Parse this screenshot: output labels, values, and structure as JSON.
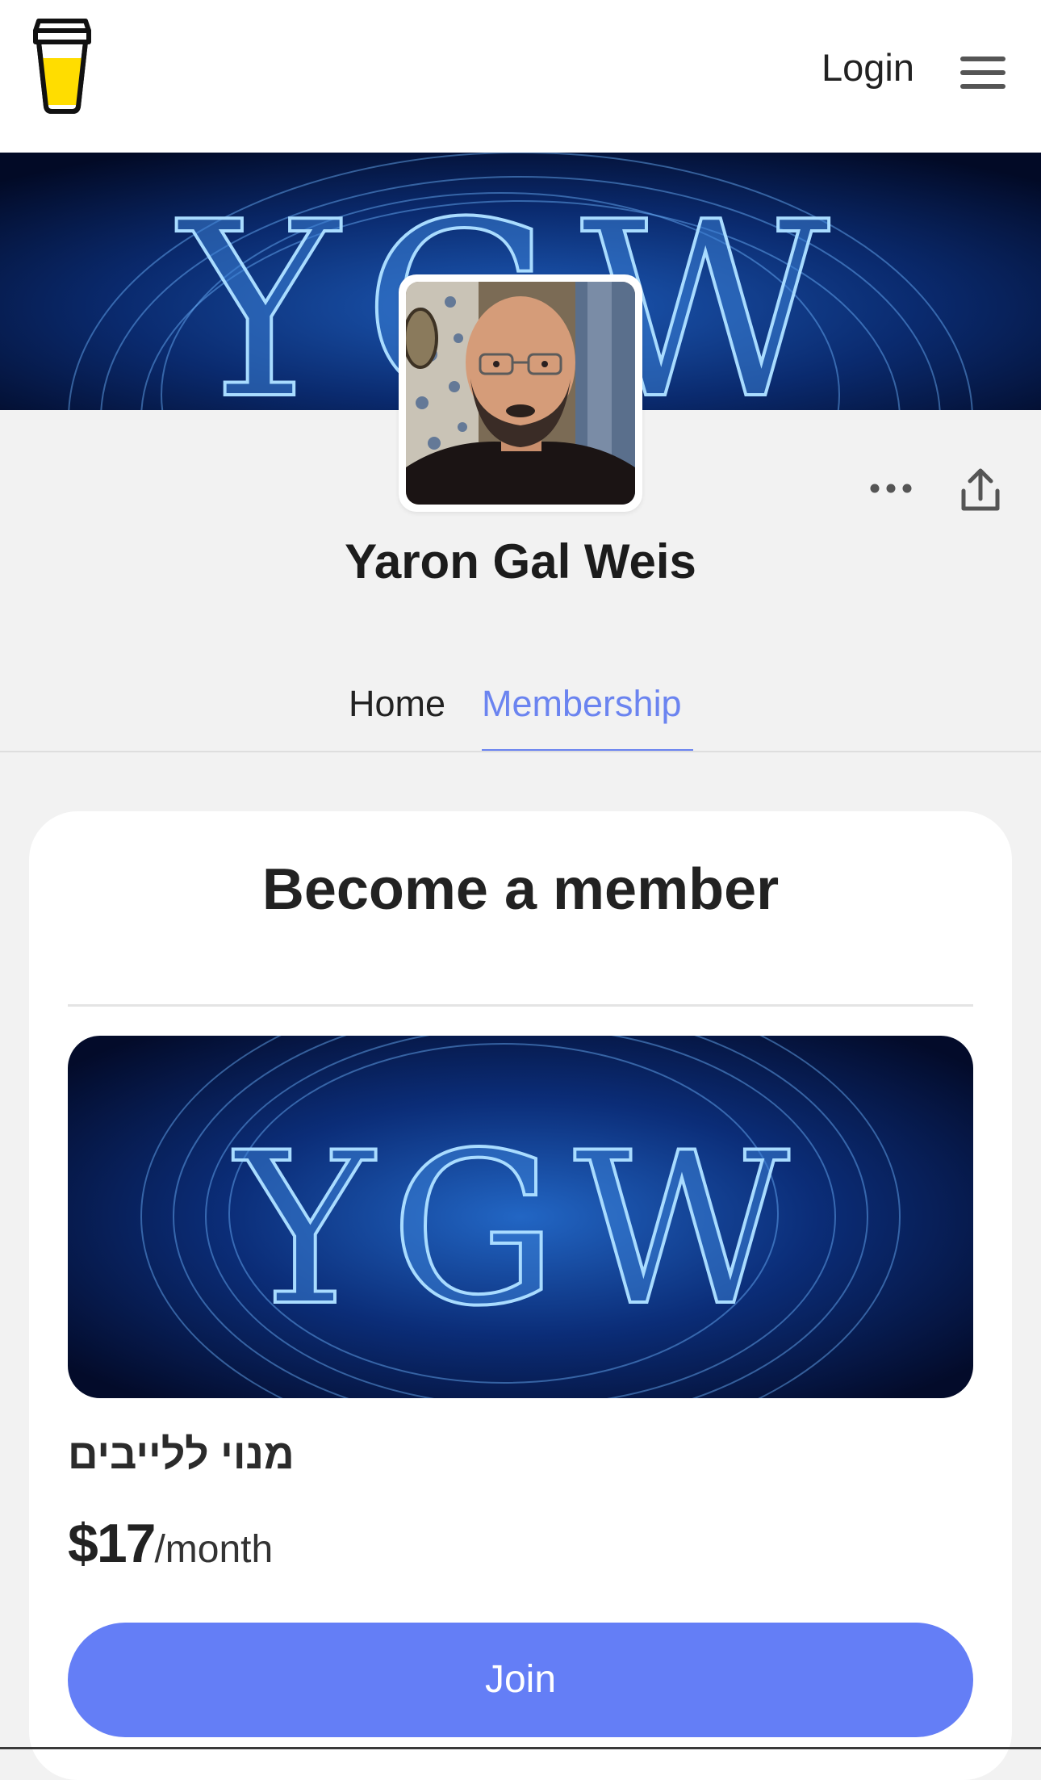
{
  "header": {
    "logo_icon": "coffee-cup-logo-icon",
    "login_label": "Login",
    "menu_icon": "hamburger-menu-icon"
  },
  "cover": {
    "lettering": "YGW",
    "background_color": "#041a4a",
    "glow_color": "#7ec8ff"
  },
  "profile": {
    "name": "Yaron Gal Weis",
    "avatar": "profile-photo",
    "more_icon": "more-options-icon",
    "share_icon": "share-icon"
  },
  "tabs": [
    {
      "label": "Home",
      "active": false
    },
    {
      "label": "Membership",
      "active": true
    }
  ],
  "membership": {
    "title": "Become a member",
    "tier": {
      "image_lettering": "YGW",
      "name": "מנוי ללייבים",
      "price": "$17",
      "period": "/month",
      "join_label": "Join"
    }
  },
  "colors": {
    "accent": "#6b84f0",
    "button": "#647ef6",
    "page_background": "#f2f2f2"
  }
}
